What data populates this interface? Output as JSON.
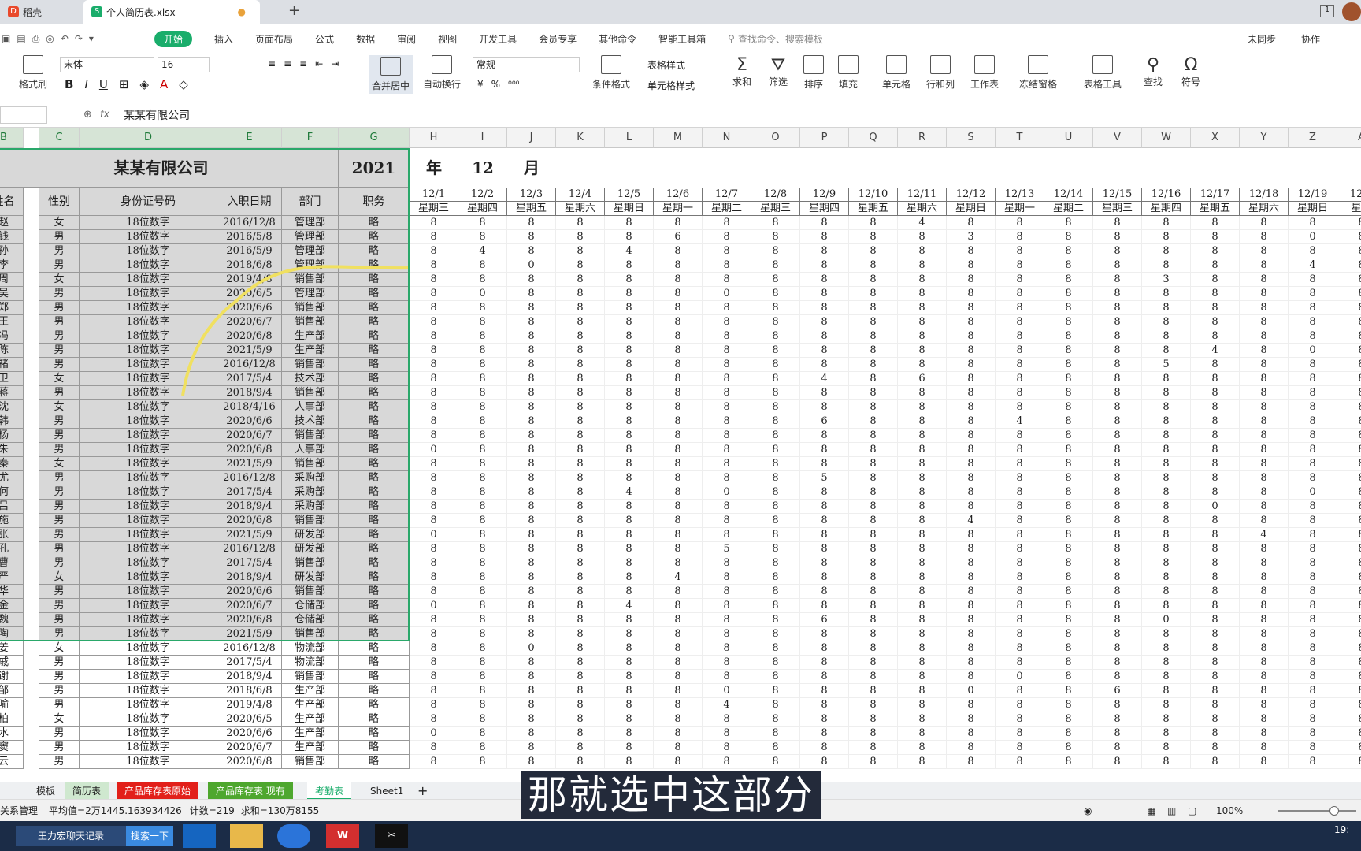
{
  "tabs": [
    {
      "label": "稻壳"
    },
    {
      "label": "个人简历表.xlsx"
    }
  ],
  "menu": [
    "开始",
    "插入",
    "页面布局",
    "公式",
    "数据",
    "审阅",
    "视图",
    "开发工具",
    "会员专享",
    "其他命令",
    "智能工具箱"
  ],
  "search_placeholder": "查找命令、搜索模板",
  "sync": "未同步",
  "collab": "协作",
  "ribbon": {
    "format_painter": "格式刷",
    "font": "宋体",
    "size": "16",
    "number_format": "常规",
    "merge": "合并居中",
    "wrap": "自动换行",
    "cond": "条件格式",
    "table_style": "表格样式",
    "cell_style": "单元格样式",
    "sum": "求和",
    "filter": "筛选",
    "sort": "排序",
    "fill": "填充",
    "cellfmt": "单元格",
    "rowcol": "行和列",
    "worksheet": "工作表",
    "freeze": "冻结窗格",
    "tabletool": "表格工具",
    "find": "查找",
    "symbol": "符号"
  },
  "formula": {
    "fx": "fx",
    "value": "某某有限公司"
  },
  "columns": [
    "B",
    "C",
    "D",
    "E",
    "F",
    "G",
    "H",
    "I",
    "J",
    "K",
    "L",
    "M",
    "N",
    "O",
    "P",
    "Q",
    "R",
    "S",
    "T",
    "U",
    "V",
    "W",
    "X",
    "Y",
    "Z",
    "A"
  ],
  "header": {
    "company": "某某有限公司",
    "year": "2021",
    "year_label": "年",
    "month": "12",
    "month_label": "月"
  },
  "fields": [
    "姓名",
    "性别",
    "身份证号码",
    "入职日期",
    "部门",
    "职务"
  ],
  "dates": [
    "12/1",
    "12/2",
    "12/3",
    "12/4",
    "12/5",
    "12/6",
    "12/7",
    "12/8",
    "12/9",
    "12/10",
    "12/11",
    "12/12",
    "12/13",
    "12/14",
    "12/15",
    "12/16",
    "12/17",
    "12/18",
    "12/19",
    "12/2"
  ],
  "weekdays": [
    "星期三",
    "星期四",
    "星期五",
    "星期六",
    "星期日",
    "星期一",
    "星期二",
    "星期三",
    "星期四",
    "星期五",
    "星期六",
    "星期日",
    "星期一",
    "星期二",
    "星期三",
    "星期四",
    "星期五",
    "星期六",
    "星期日",
    "星期"
  ],
  "rows": [
    [
      "赵",
      "女",
      "18位数字",
      "2016/12/8",
      "管理部",
      "略"
    ],
    [
      "钱",
      "男",
      "18位数字",
      "2016/5/8",
      "管理部",
      "略"
    ],
    [
      "孙",
      "男",
      "18位数字",
      "2016/5/9",
      "管理部",
      "略"
    ],
    [
      "李",
      "男",
      "18位数字",
      "2018/6/8",
      "管理部",
      "略"
    ],
    [
      "周",
      "女",
      "18位数字",
      "2019/4/8",
      "销售部",
      "略"
    ],
    [
      "吴",
      "男",
      "18位数字",
      "2020/6/5",
      "管理部",
      "略"
    ],
    [
      "郑",
      "男",
      "18位数字",
      "2020/6/6",
      "销售部",
      "略"
    ],
    [
      "王",
      "男",
      "18位数字",
      "2020/6/7",
      "销售部",
      "略"
    ],
    [
      "冯",
      "男",
      "18位数字",
      "2020/6/8",
      "生产部",
      "略"
    ],
    [
      "陈",
      "男",
      "18位数字",
      "2021/5/9",
      "生产部",
      "略"
    ],
    [
      "褚",
      "男",
      "18位数字",
      "2016/12/8",
      "销售部",
      "略"
    ],
    [
      "卫",
      "女",
      "18位数字",
      "2017/5/4",
      "技术部",
      "略"
    ],
    [
      "蒋",
      "男",
      "18位数字",
      "2018/9/4",
      "销售部",
      "略"
    ],
    [
      "沈",
      "女",
      "18位数字",
      "2018/4/16",
      "人事部",
      "略"
    ],
    [
      "韩",
      "男",
      "18位数字",
      "2020/6/6",
      "技术部",
      "略"
    ],
    [
      "杨",
      "男",
      "18位数字",
      "2020/6/7",
      "销售部",
      "略"
    ],
    [
      "朱",
      "男",
      "18位数字",
      "2020/6/8",
      "人事部",
      "略"
    ],
    [
      "秦",
      "女",
      "18位数字",
      "2021/5/9",
      "销售部",
      "略"
    ],
    [
      "尤",
      "男",
      "18位数字",
      "2016/12/8",
      "采购部",
      "略"
    ],
    [
      "何",
      "男",
      "18位数字",
      "2017/5/4",
      "采购部",
      "略"
    ],
    [
      "吕",
      "男",
      "18位数字",
      "2018/9/4",
      "采购部",
      "略"
    ],
    [
      "施",
      "男",
      "18位数字",
      "2020/6/8",
      "销售部",
      "略"
    ],
    [
      "张",
      "男",
      "18位数字",
      "2021/5/9",
      "研发部",
      "略"
    ],
    [
      "孔",
      "男",
      "18位数字",
      "2016/12/8",
      "研发部",
      "略"
    ],
    [
      "曹",
      "男",
      "18位数字",
      "2017/5/4",
      "销售部",
      "略"
    ],
    [
      "严",
      "女",
      "18位数字",
      "2018/9/4",
      "研发部",
      "略"
    ],
    [
      "华",
      "男",
      "18位数字",
      "2020/6/6",
      "销售部",
      "略"
    ],
    [
      "金",
      "男",
      "18位数字",
      "2020/6/7",
      "仓储部",
      "略"
    ],
    [
      "魏",
      "男",
      "18位数字",
      "2020/6/8",
      "仓储部",
      "略"
    ],
    [
      "陶",
      "男",
      "18位数字",
      "2021/5/9",
      "销售部",
      "略"
    ],
    [
      "姜",
      "女",
      "18位数字",
      "2016/12/8",
      "物流部",
      "略"
    ],
    [
      "戚",
      "男",
      "18位数字",
      "2017/5/4",
      "物流部",
      "略"
    ],
    [
      "谢",
      "男",
      "18位数字",
      "2018/9/4",
      "销售部",
      "略"
    ],
    [
      "邹",
      "男",
      "18位数字",
      "2018/6/8",
      "生产部",
      "略"
    ],
    [
      "喻",
      "男",
      "18位数字",
      "2019/4/8",
      "生产部",
      "略"
    ],
    [
      "柏",
      "女",
      "18位数字",
      "2020/6/5",
      "生产部",
      "略"
    ],
    [
      "水",
      "男",
      "18位数字",
      "2020/6/6",
      "生产部",
      "略"
    ],
    [
      "窦",
      "男",
      "18位数字",
      "2020/6/7",
      "生产部",
      "略"
    ],
    [
      "云",
      "男",
      "18位数字",
      "2020/6/8",
      "销售部",
      "略"
    ]
  ],
  "hours": [
    "88888888884888888888",
    "88888688888388888808",
    "84884888888888888888",
    "88088888888888888848",
    "88888888888888838888",
    "80888808888888888888",
    "88888888888888888888",
    "88888888888888888888",
    "88888888888888888888",
    "88888888888888884808",
    "88888888888888858888",
    "88888888486888888888",
    "88888888888888888888",
    "88888888888888888888",
    "88888888688848888888",
    "88888888888888888888",
    "08888888888888888888",
    "88888888888888888888",
    "88888888588888888888",
    "88884808888888888808",
    "88888888888888880888",
    "88888888888488888888",
    "08888888888888888488",
    "88888858888888888888",
    "88888888888888888888",
    "88888488888888888888",
    "88888888888888888888",
    "08884888888888888888",
    "88888888688888808888",
    "88888888888888888888",
    "88088888888888888888",
    "88888888888888888888",
    "88888888888808888888",
    "88888808888088688888",
    "88888848888888888888",
    "88888888888888888888",
    "08888888888888888888",
    "88888888888888888888",
    "88888888888888888888"
  ],
  "sheets": [
    "模板",
    "简历表",
    "产品库存表原始",
    "产品库存表 现有",
    "考勤表",
    "Sheet1"
  ],
  "status": {
    "left": "关系管理",
    "avg": "平均值=2万1445.163934426",
    "count": "计数=219",
    "sum": "求和=130万8155",
    "zoom": "100%"
  },
  "taskbar": {
    "chat": "王力宏聊天记录",
    "search": "搜索一下",
    "clock": "19:"
  },
  "subtitle": "那就选中这部分"
}
